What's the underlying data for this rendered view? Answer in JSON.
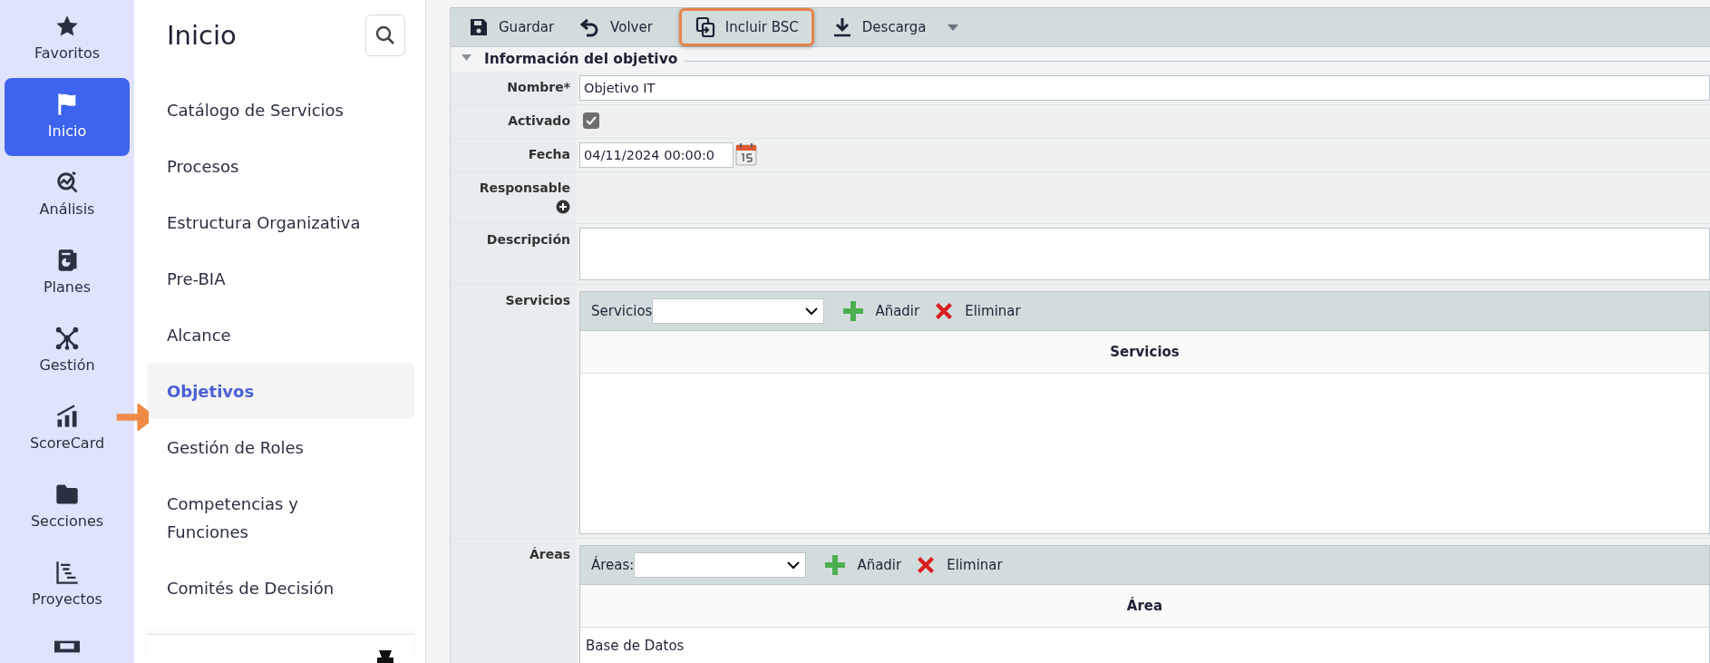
{
  "rail": {
    "items": [
      {
        "label": "Favoritos",
        "selected": false
      },
      {
        "label": "Inicio",
        "selected": true
      },
      {
        "label": "Análisis",
        "selected": false
      },
      {
        "label": "Planes",
        "selected": false
      },
      {
        "label": "Gestión",
        "selected": false
      },
      {
        "label": "ScoreCard",
        "selected": false
      },
      {
        "label": "Secciones",
        "selected": false
      },
      {
        "label": "Proyectos",
        "selected": false
      },
      {
        "selected": false
      }
    ]
  },
  "nav": {
    "title": "Inicio",
    "items": [
      {
        "label": "Catálogo de Servicios",
        "selected": false
      },
      {
        "label": "Procesos",
        "selected": false
      },
      {
        "label": "Estructura Organizativa",
        "selected": false
      },
      {
        "label": "Pre-BIA",
        "selected": false
      },
      {
        "label": "Alcance",
        "selected": false
      },
      {
        "label": "Objetivos",
        "selected": true
      },
      {
        "label": "Gestión de Roles",
        "selected": false
      },
      {
        "label": "Competencias y Funciones",
        "selected": false
      },
      {
        "label": "Comités de Decisión",
        "selected": false
      }
    ]
  },
  "toolbar": {
    "buttons": [
      {
        "label": "Guardar",
        "highlighted": false,
        "dropdown": false
      },
      {
        "label": "Volver",
        "highlighted": false,
        "dropdown": false
      },
      {
        "label": "Incluir BSC",
        "highlighted": true,
        "dropdown": false
      },
      {
        "label": "Descarga",
        "highlighted": false,
        "dropdown": true
      }
    ]
  },
  "section": {
    "title": "Información del objetivo",
    "expanded": true
  },
  "fields": [
    {
      "kind": "text",
      "label": "Nombre*",
      "value": "Objetivo IT"
    },
    {
      "kind": "checkbox",
      "label": "Activado",
      "checked": true
    },
    {
      "kind": "date",
      "label": "Fecha",
      "value": "04/11/2024 00:00:0"
    },
    {
      "kind": "add",
      "label": "Responsable"
    },
    {
      "kind": "textarea",
      "label": "Descripción"
    },
    {
      "kind": "grid",
      "label": "Servicios",
      "picker_label": "Servicios",
      "add": "Añadir",
      "remove": "Eliminar",
      "columns": [
        "Servicios"
      ]
    },
    {
      "kind": "grid",
      "label": "Áreas",
      "picker_label": "Áreas:",
      "add": "Añadir",
      "remove": "Eliminar",
      "columns": [
        "Área"
      ],
      "rows": [
        [
          "Base de Datos"
        ]
      ]
    }
  ]
}
